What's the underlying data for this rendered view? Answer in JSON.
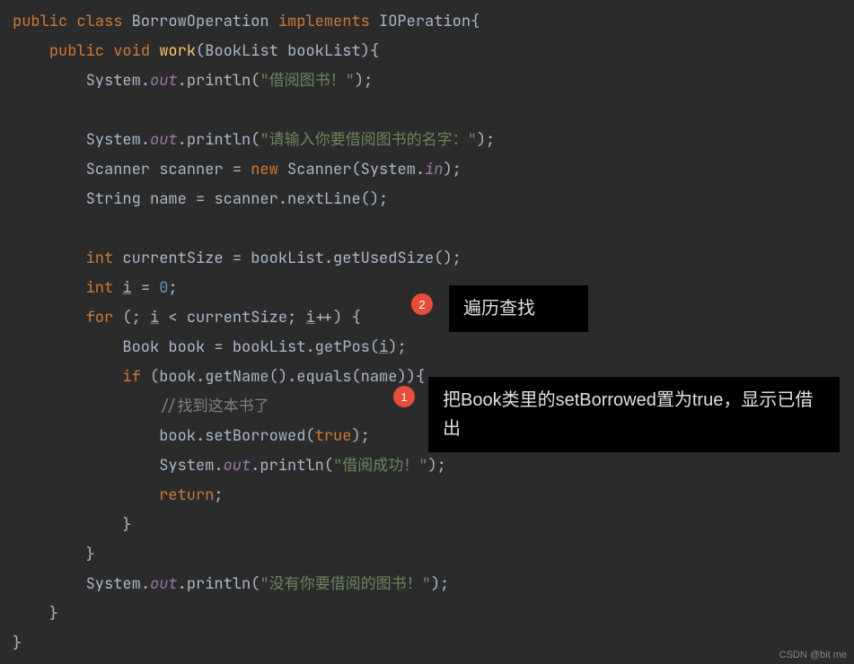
{
  "code": {
    "line1_kw1": "public",
    "line1_kw2": "class",
    "line1_cls": "BorrowOperation",
    "line1_kw3": "implements",
    "line1_iface": "IOPeration",
    "line1_brace": "{",
    "line2_kw1": "public",
    "line2_kw2": "void",
    "line2_method": "work",
    "line2_params_open": "(",
    "line2_param_type": "BookList",
    "line2_param_name": "bookList",
    "line2_params_close": ")",
    "line2_brace": "{",
    "line3_sys": "System",
    "line3_dot1": ".",
    "line3_out": "out",
    "line3_dot2": ".",
    "line3_println": "println",
    "line3_open": "(",
    "line3_str": "\"借阅图书！\"",
    "line3_close": ");",
    "line5_sys": "System",
    "line5_dot1": ".",
    "line5_out": "out",
    "line5_dot2": ".",
    "line5_println": "println",
    "line5_open": "(",
    "line5_str": "\"请输入你要借阅图书的名字：\"",
    "line5_close": ");",
    "line6_type": "Scanner",
    "line6_var": "scanner",
    "line6_eq": " = ",
    "line6_new": "new",
    "line6_sp": " ",
    "line6_ctor": "Scanner",
    "line6_open": "(",
    "line6_sys": "System",
    "line6_dot": ".",
    "line6_in": "in",
    "line6_close": ");",
    "line7_type": "String",
    "line7_var": "name",
    "line7_eq": " = ",
    "line7_scanner": "scanner",
    "line7_dot": ".",
    "line7_nextline": "nextLine",
    "line7_call": "();",
    "line9_int": "int",
    "line9_var": "currentSize",
    "line9_eq": " = ",
    "line9_obj": "bookList",
    "line9_dot": ".",
    "line9_method": "getUsedSize",
    "line9_call": "();",
    "line10_int": "int",
    "line10_var": "i",
    "line10_eq": " = ",
    "line10_val": "0",
    "line10_semi": ";",
    "line11_for": "for",
    "line11_open": " (; ",
    "line11_i1": "i",
    "line11_lt": " < ",
    "line11_cs": "currentSize",
    "line11_semi": "; ",
    "line11_i2": "i",
    "line11_inc": "++) {",
    "line12_type": "Book",
    "line12_var": "book",
    "line12_eq": " = ",
    "line12_obj": "bookList",
    "line12_dot": ".",
    "line12_method": "getPos",
    "line12_open": "(",
    "line12_i": "i",
    "line12_close": ");",
    "line13_if": "if",
    "line13_open": " (",
    "line13_book": "book",
    "line13_dot1": ".",
    "line13_getname": "getName",
    "line13_call1": "()",
    "line13_dot2": ".",
    "line13_equals": "equals",
    "line13_open2": "(",
    "line13_name": "name",
    "line13_close": ")){",
    "line14_comment": "//找到这本书了",
    "line15_book": "book",
    "line15_dot": ".",
    "line15_method": "setBorrowed",
    "line15_open": "(",
    "line15_true": "true",
    "line15_close": ");",
    "line16_sys": "System",
    "line16_dot1": ".",
    "line16_out": "out",
    "line16_dot2": ".",
    "line16_println": "println",
    "line16_open": "(",
    "line16_str": "\"借阅成功！\"",
    "line16_close": ");",
    "line17_return": "return",
    "line17_semi": ";",
    "line18_brace": "}",
    "line19_brace": "}",
    "line20_sys": "System",
    "line20_dot1": ".",
    "line20_out": "out",
    "line20_dot2": ".",
    "line20_println": "println",
    "line20_open": "(",
    "line20_str": "\"没有你要借阅的图书！\"",
    "line20_close": ");",
    "line21_brace": "}",
    "line22_brace": "}"
  },
  "annotations": {
    "badge1_num": "1",
    "badge1_text": "把Book类里的setBorrowed置为true，显示已借出",
    "badge2_num": "2",
    "badge2_text": "遍历查找"
  },
  "watermark": "CSDN @bit me"
}
